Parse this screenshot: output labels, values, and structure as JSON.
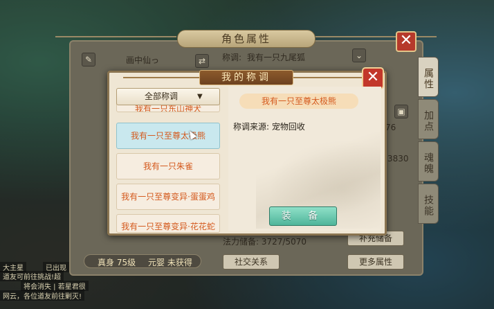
{
  "world": {
    "chat_lines": [
      "大主星",
      "已出现",
      "道友可前往挑战!超",
      "将会消失 | 若星君很",
      "网云，各位道友前往剿灭!"
    ]
  },
  "character_panel": {
    "title": "角色属性",
    "name": "画中仙っ",
    "title_label": "称调:",
    "current_title": "我有一只九尾狐",
    "tabs": [
      "属性",
      "加点",
      "魂魄",
      "技能"
    ],
    "stats": {
      "value_a": "76",
      "value_b": "3830",
      "potential": "法力储备: 3727/5070"
    },
    "realm": "真身 75级",
    "yuanying": "元婴 未获得",
    "social_button": "社交关系",
    "more_button": "更多属性",
    "fill_button": "补充储备"
  },
  "dialog": {
    "title": "我的称调",
    "filter_label": "全部称调",
    "titles": [
      "我有一只东山神犬",
      "我有一只至尊太极熊",
      "我有一只朱雀",
      "我有一只至尊变异·蛋蛋鸡",
      "我有一只至尊变异·花花蛇"
    ],
    "selected_title": "我有一只至尊太极熊",
    "source_label": "称调来源: 宠物回收",
    "equip_button": "装 备"
  },
  "colors": {
    "title_text": "#d45a1e",
    "equip_button": "#4fb59a",
    "close_button": "#c2372a"
  }
}
